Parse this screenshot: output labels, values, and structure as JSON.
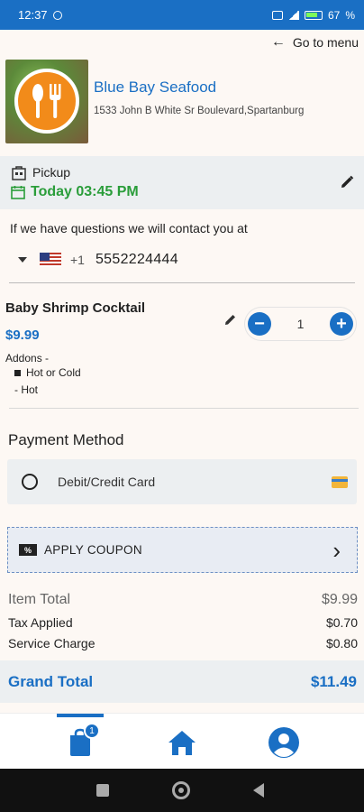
{
  "status_bar": {
    "time": "12:37",
    "battery": "67"
  },
  "header": {
    "goto_label": "Go to menu"
  },
  "restaurant": {
    "name": "Blue Bay Seafood",
    "address": "1533 John B White Sr Boulevard,Spartanburg"
  },
  "pickup": {
    "mode": "Pickup",
    "time": "Today 03:45 PM"
  },
  "contact": {
    "label": "If we have questions we will contact you at",
    "dial_code": "+1",
    "phone": "5552224444"
  },
  "cart_item": {
    "name": "Baby Shrimp Cocktail",
    "price": "$9.99",
    "addons_label": "Addons -",
    "addon_group": "Hot or Cold",
    "addon_value": "- Hot",
    "quantity": "1"
  },
  "payment": {
    "title": "Payment Method",
    "option_label": "Debit/Credit Card"
  },
  "coupon": {
    "icon_text": "%",
    "label": "APPLY COUPON"
  },
  "summary": {
    "item_total_label": "Item Total",
    "item_total": "$9.99",
    "tax_label": "Tax Applied",
    "tax": "$0.70",
    "service_label": "Service Charge",
    "service": "$0.80",
    "grand_label": "Grand Total",
    "grand": "$11.49"
  },
  "bottom_nav": {
    "cart_badge": "1",
    "active_tab": "cart"
  },
  "colors": {
    "accent": "#1a6fc4",
    "success": "#2a9d3a",
    "band": "#eceff1"
  },
  "icons": [
    "wifi-icon",
    "signal-icon",
    "battery-icon",
    "arrow-left-icon",
    "pickup-bag-icon",
    "calendar-icon",
    "pencil-icon",
    "caret-down-icon",
    "us-flag-icon",
    "minus-icon",
    "plus-icon",
    "radio-icon",
    "credit-card-icon",
    "coupon-icon",
    "chevron-right-icon",
    "cart-icon",
    "home-icon",
    "profile-icon"
  ]
}
